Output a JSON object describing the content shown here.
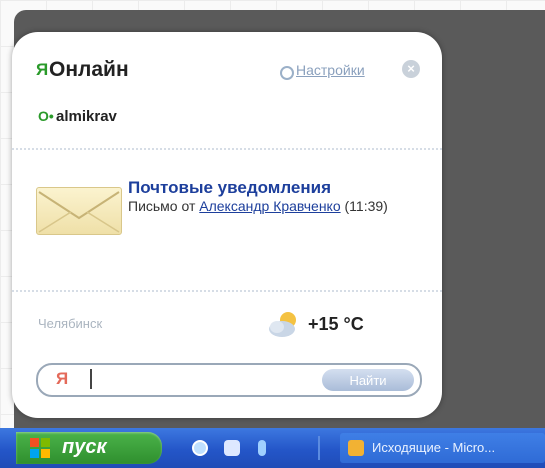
{
  "gadget": {
    "logo_letter": "Я",
    "title": "Онлайн",
    "settings_label": "Настройки",
    "user": {
      "username": "almikrav"
    }
  },
  "mail": {
    "title": "Почтовые уведомления",
    "prefix": "Письмо от",
    "sender": "Александр Кравченко",
    "time": "(11:39)"
  },
  "weather": {
    "city": "Челябинск",
    "temperature": "+15 °C"
  },
  "search": {
    "logo_letter": "Я",
    "value": "",
    "button_label": "Найти"
  },
  "taskbar": {
    "start_label": "пуск",
    "task_label": "Исходящие - Micro..."
  },
  "colors": {
    "accent_green": "#2a9a2a",
    "link_blue": "#1d3f9c",
    "taskbar_blue": "#2456c8"
  }
}
